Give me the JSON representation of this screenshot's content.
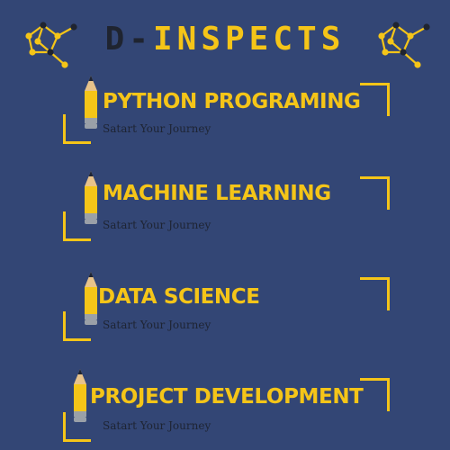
{
  "brand": {
    "title_prefix": "D-",
    "title_rest": "INSPECTS",
    "icon": "network-molecule-icon"
  },
  "courses": [
    {
      "title": "PYTHON PROGRAMING",
      "subtitle": "Satart Your Journey"
    },
    {
      "title": "MACHINE LEARNING",
      "subtitle": "Satart Your Journey"
    },
    {
      "title": "DATA SCIENCE",
      "subtitle": "Satart Your Journey"
    },
    {
      "title": "PROJECT DEVELOPMENT",
      "subtitle": "Satart Your Journey"
    }
  ],
  "colors": {
    "background": "#334675",
    "accent": "#f5c518",
    "dark": "#1f2430",
    "text_dark": "#1e2433",
    "pencil_wood": "#e8c38a",
    "pencil_metal": "#9aa0a8"
  }
}
